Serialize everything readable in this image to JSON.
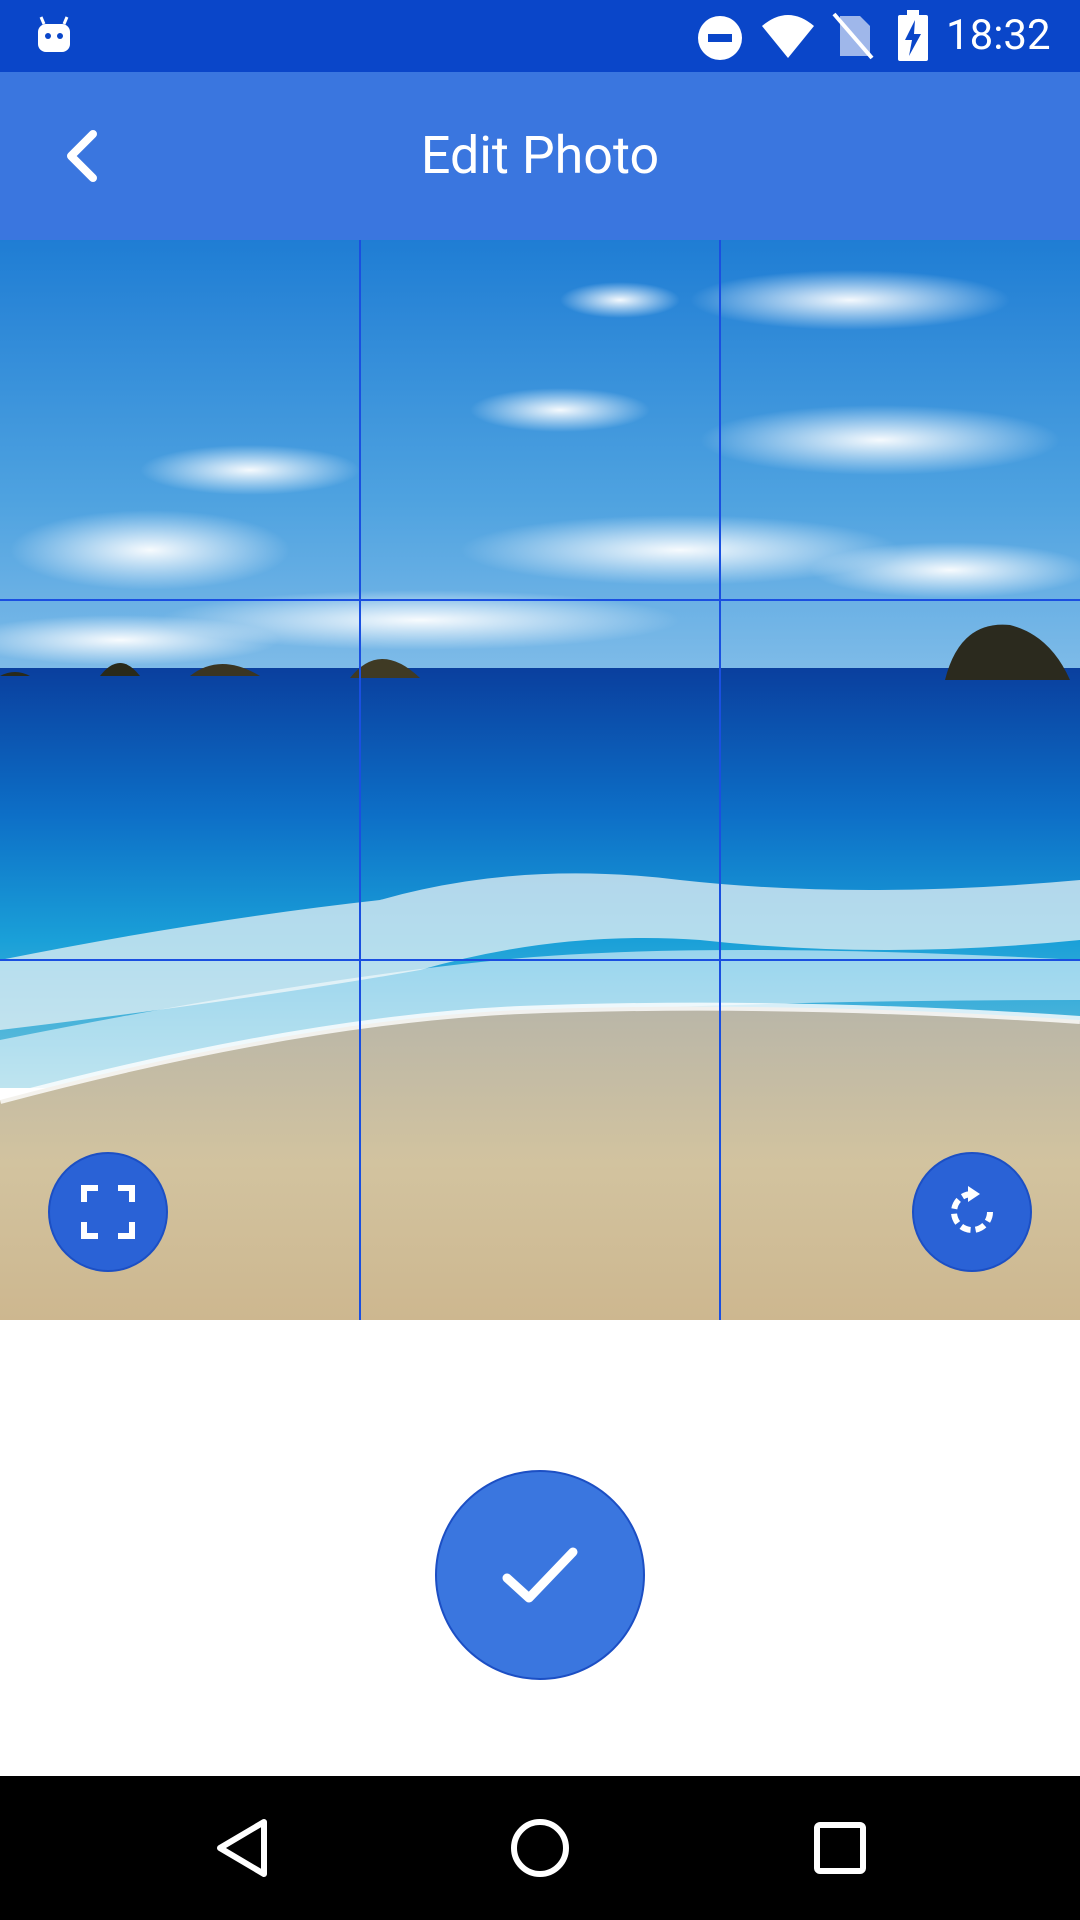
{
  "status_bar": {
    "time": "18:32",
    "icons": [
      "android-debug-icon",
      "do-not-disturb-icon",
      "wifi-icon",
      "no-sim-icon",
      "battery-charging-icon"
    ]
  },
  "app_bar": {
    "title": "Edit Photo",
    "back_icon": "chevron-left-icon"
  },
  "photo_editor": {
    "image": "beach-photo",
    "grid": "3x3",
    "fullscreen_icon": "fullscreen-icon",
    "rotate_icon": "rotate-icon"
  },
  "confirm": {
    "icon": "check-icon"
  },
  "nav_bar": {
    "icons": [
      "back-triangle-icon",
      "home-circle-icon",
      "recents-square-icon"
    ]
  },
  "colors": {
    "status_bar": "#0a46c9",
    "app_bar": "#3a76df",
    "accent": "#2a62d6",
    "grid_line": "#1a4fe0"
  }
}
